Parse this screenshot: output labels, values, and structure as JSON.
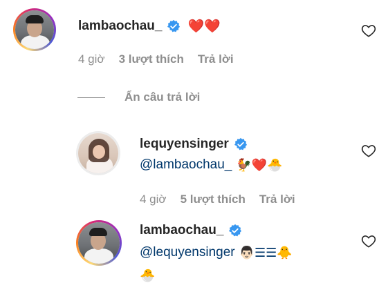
{
  "comments": [
    {
      "username": "lambaochau_",
      "text": "❤️❤️",
      "time": "4 giờ",
      "likes": "3 lượt thích",
      "reply": "Trả lời",
      "verified": true
    },
    {
      "username": "lequyensinger",
      "mention": "@lambaochau_",
      "emojis": "🐓❤️🐣",
      "time": "4 giờ",
      "likes": "5 lượt thích",
      "reply": "Trả lời",
      "verified": true
    },
    {
      "username": "lambaochau_",
      "mention": "@lequyensinger",
      "emojis": "👨🏻☰☰🐥",
      "emojis_line2": "🐣",
      "verified": true
    }
  ],
  "replies_toggle": "Ẩn câu trả lời",
  "colors": {
    "verified": "#3897f0",
    "link": "#00376b",
    "meta": "#8e8e8e"
  },
  "icons": [
    "heart-outline-icon",
    "verified-badge-icon"
  ]
}
